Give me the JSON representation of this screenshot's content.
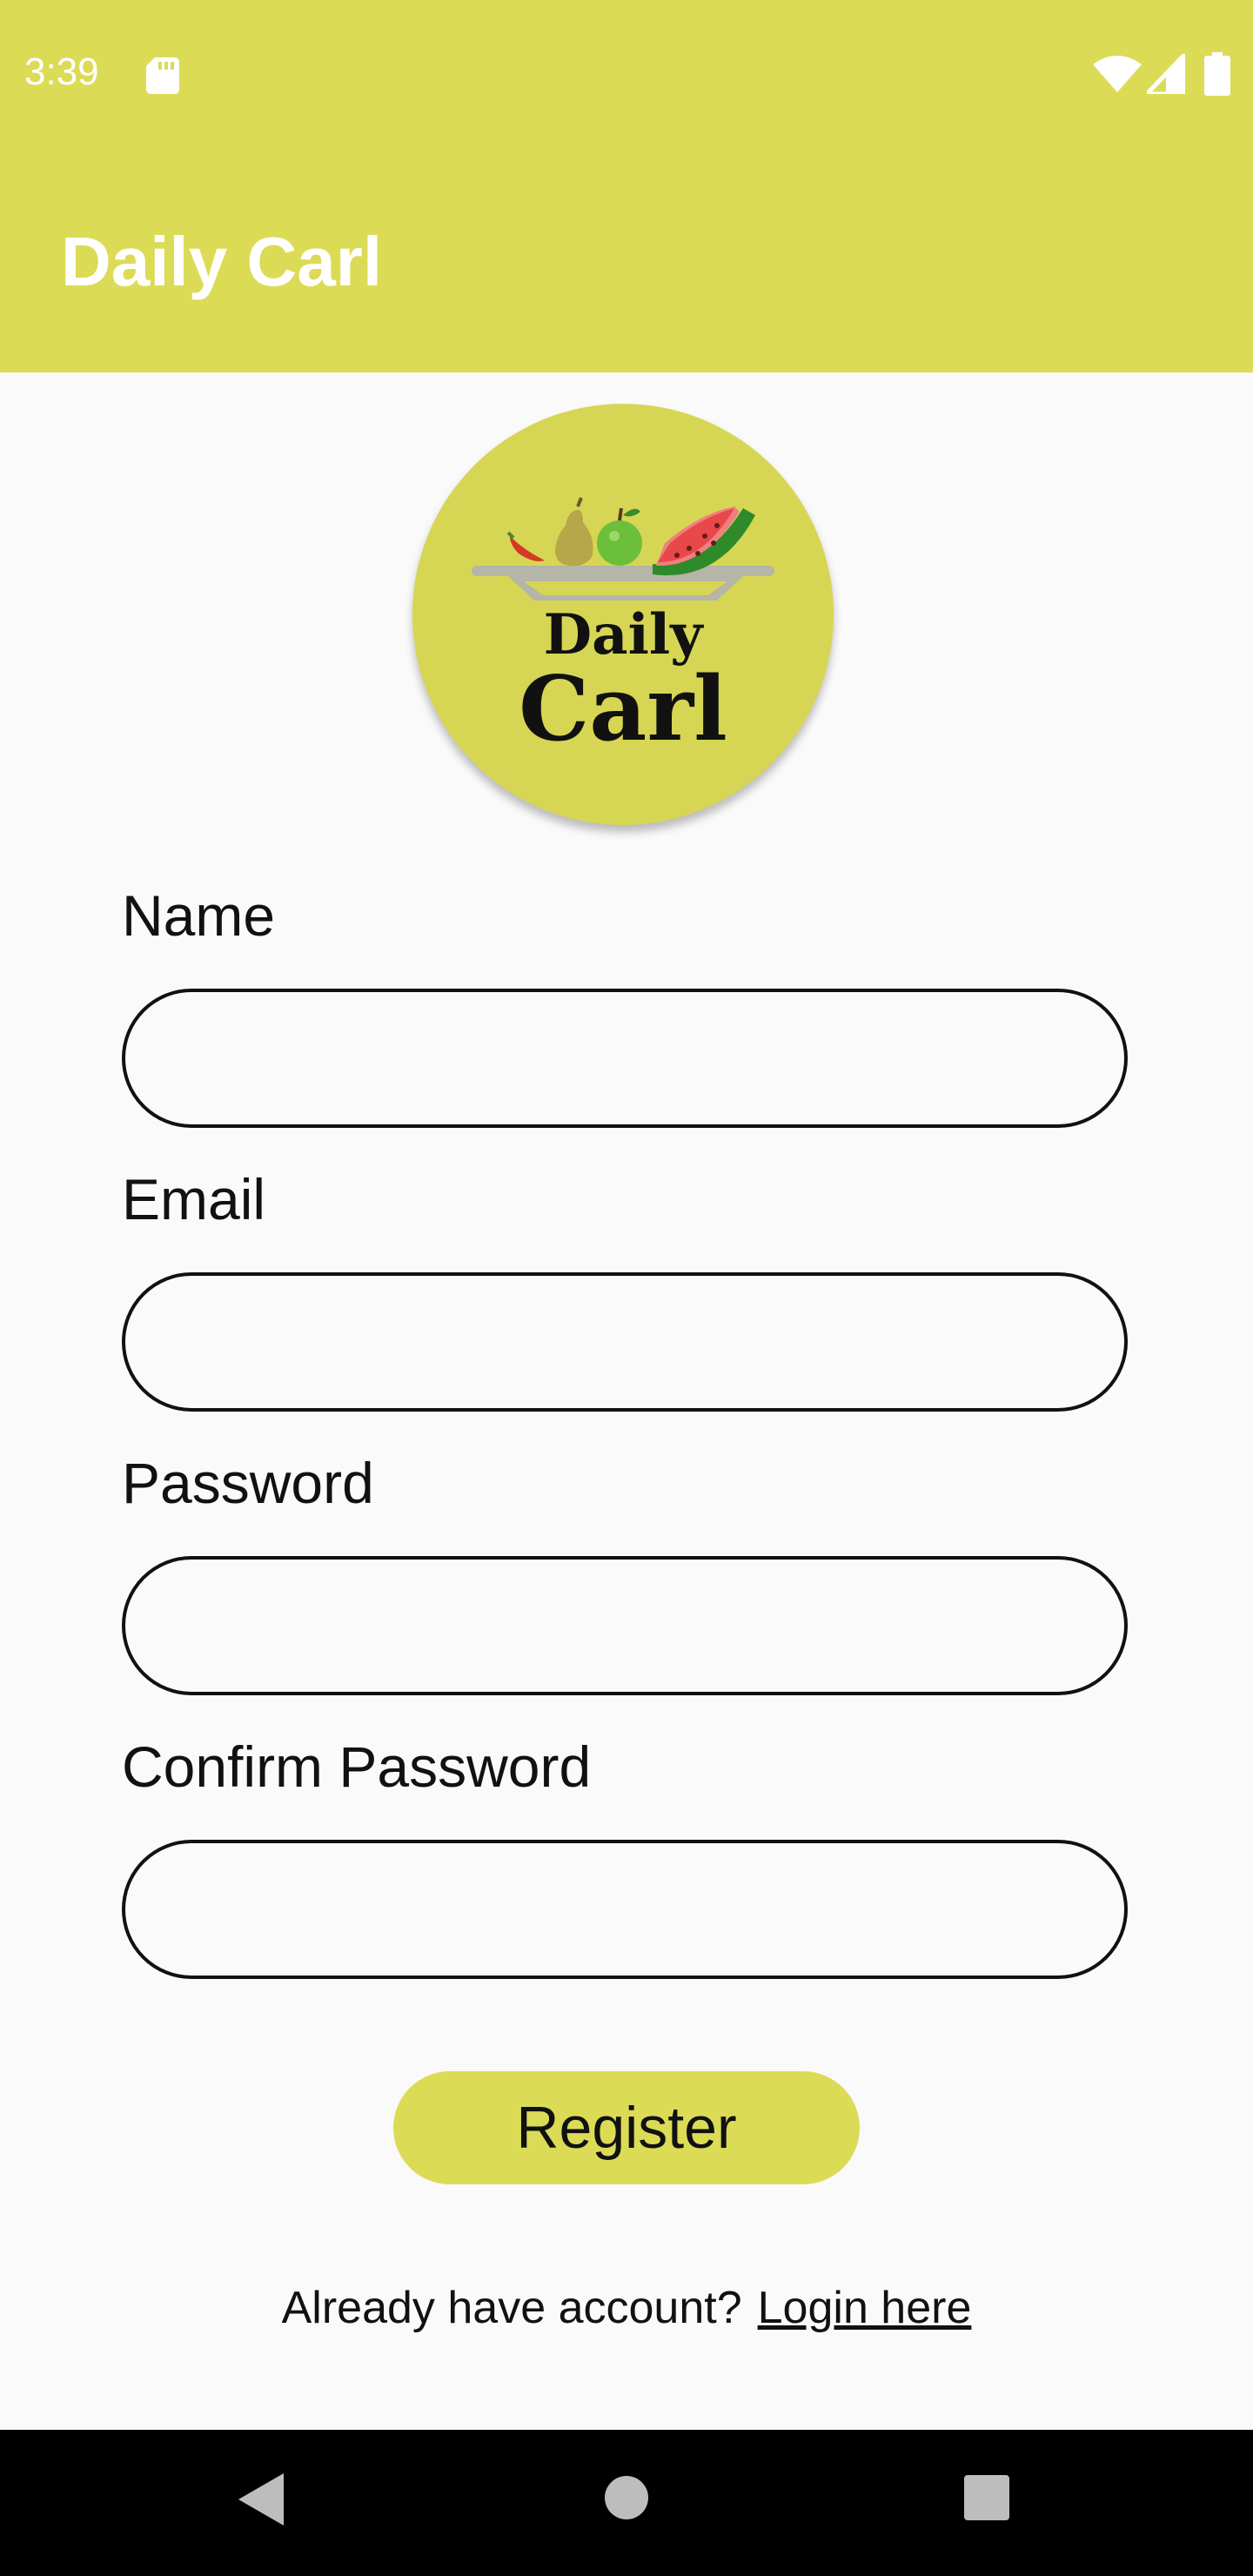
{
  "status_bar": {
    "time": "3:39",
    "background": "#dcdb56",
    "icons": [
      "sd-card-icon",
      "wifi-icon",
      "signal-icon",
      "battery-icon"
    ]
  },
  "app_bar": {
    "title": "Daily Carl",
    "background": "#dcdb56"
  },
  "logo": {
    "line1": "Daily",
    "line2": "Carl",
    "circle_color": "#d6d654"
  },
  "form": {
    "name_label": "Name",
    "name_value": "",
    "email_label": "Email",
    "email_value": "",
    "password_label": "Password",
    "password_value": "",
    "confirm_password_label": "Confirm Password",
    "confirm_password_value": ""
  },
  "register_button": {
    "label": "Register",
    "color": "#dcdb56"
  },
  "login_prompt": {
    "text": "Already have account?",
    "link": "Login here"
  },
  "nav_bar": {
    "icons": [
      "back-icon",
      "home-icon",
      "recents-icon"
    ]
  }
}
